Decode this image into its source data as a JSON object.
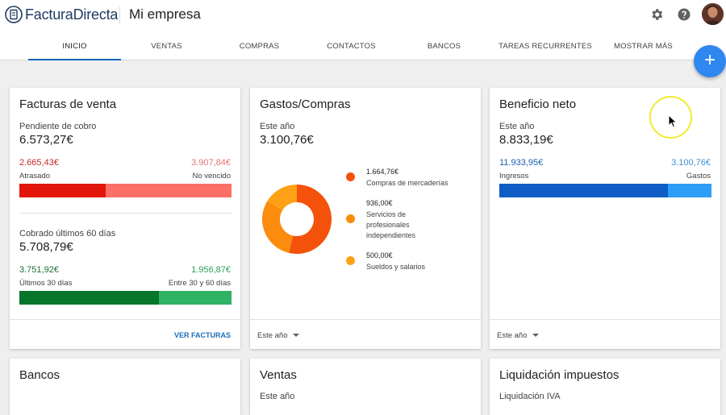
{
  "app": {
    "name": "FacturaDirecta",
    "company": "Mi empresa"
  },
  "nav": {
    "tabs": [
      "INICIO",
      "VENTAS",
      "COMPRAS",
      "CONTACTOS",
      "BANCOS",
      "TAREAS RECURRENTES",
      "MOSTRAR MÁS"
    ],
    "active": "INICIO"
  },
  "fab": {
    "label": "+"
  },
  "facturas": {
    "title": "Facturas de venta",
    "pending_label": "Pendiente de cobro",
    "pending_total": "6.573,27€",
    "overdue_value": "2.665,43€",
    "overdue_label": "Atrasado",
    "notdue_value": "3.907,84€",
    "notdue_label": "No vencido",
    "overdue_fraction": 0.405,
    "collected_label": "Cobrado últimos 60 días",
    "collected_total": "5.708,79€",
    "last30_value": "3.751,92€",
    "last30_label": "Últimos 30 días",
    "between_value": "1.956,87€",
    "between_label": "Entre 30 y 60 días",
    "last30_fraction": 0.657,
    "link": "VER FACTURAS",
    "colors": {
      "overdue": "#e3160b",
      "notdue": "#fb6f66",
      "last30": "#08752c",
      "between": "#2fb264"
    }
  },
  "gastos": {
    "title": "Gastos/Compras",
    "period_label": "Este año",
    "total": "3.100,76€",
    "legend": [
      {
        "value": "1.664,76€",
        "name": "Compras de mercaderías",
        "color": "#f4510b"
      },
      {
        "value": "936,00€",
        "name": "Servicios de profesionales independientes",
        "color": "#fb8c0e"
      },
      {
        "value": "500,00€",
        "name": "Sueldos y salarios",
        "color": "#ffa114"
      }
    ],
    "period_select": "Este año"
  },
  "beneficio": {
    "title": "Beneficio neto",
    "period_label": "Este año",
    "total": "8.833,19€",
    "income_value": "11.933,95€",
    "income_label": "Ingresos",
    "expense_value": "3.100,76€",
    "expense_label": "Gastos",
    "income_fraction": 0.794,
    "period_select": "Este año",
    "colors": {
      "income": "#0f5dc4",
      "expense": "#2c9ef5"
    }
  },
  "bottom": {
    "bancos_title": "Bancos",
    "ventas_title": "Ventas",
    "ventas_sub": "Este año",
    "liq_title": "Liquidación impuestos",
    "liq_sub": "Liquidación IVA"
  }
}
